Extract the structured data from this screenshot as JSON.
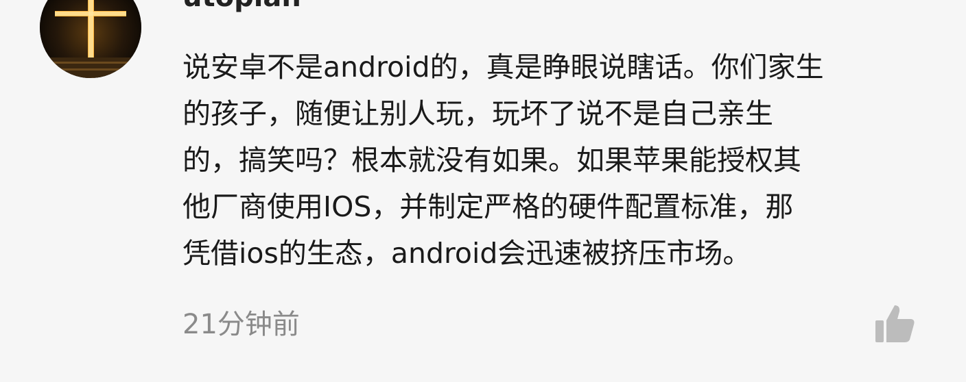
{
  "comment": {
    "username": "utopian",
    "body_lines": [
      "说安卓不是android的，真是睁眼说瞎话。你们家生",
      "的孩子，随便让别人玩，玩坏了说不是自己亲生",
      "的，搞笑吗？根本就没有如果。如果苹果能授权其",
      "他厂商使用IOS，并制定严格的硬件配置标准，那",
      "凭借ios的生态，android会迅速被挤压市场。"
    ],
    "timestamp": "21分钟前",
    "avatar_icon": "glowing-cross-avatar",
    "like_icon": "thumbs-up-icon"
  },
  "colors": {
    "background": "#f6f6f6",
    "text": "#1a1a1a",
    "muted": "#8a8a8a",
    "icon": "#bcbcbc"
  }
}
